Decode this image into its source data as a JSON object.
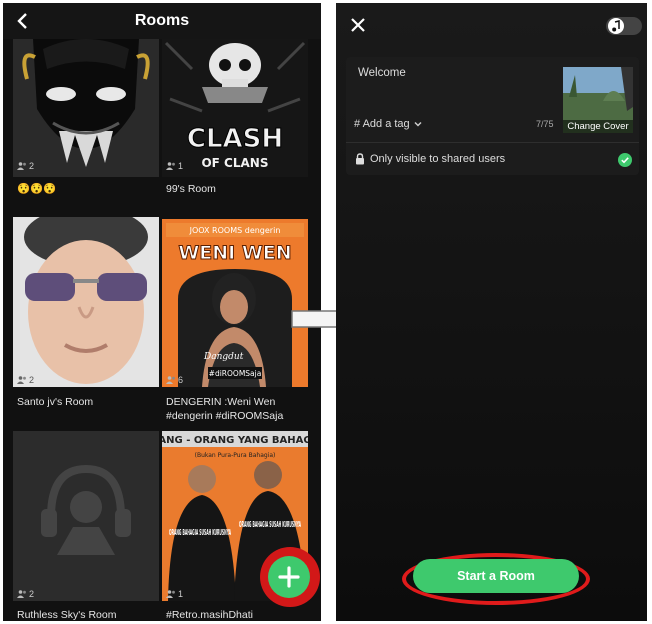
{
  "left_screen": {
    "title": "Rooms",
    "rooms": [
      {
        "name": "😯😯😯",
        "users": "2",
        "art": "demon-mask"
      },
      {
        "name": "99's Room",
        "users": "1",
        "art": "clash-of-clans"
      },
      {
        "name": "Santo jv's Room",
        "users": "2",
        "art": "man-sunglasses"
      },
      {
        "name": "DENGERIN :Weni Wen #dengerin #diROOMSaja",
        "users": "6",
        "art": "weni-wen-poster"
      },
      {
        "name": "Ruthless Sky's Room",
        "users": "2",
        "art": "headphones-placeholder"
      },
      {
        "name": "#Retro.masihDhati",
        "users": "1",
        "art": "orang-bahagia-poster"
      }
    ],
    "art_text": {
      "clash_top": "CLASH",
      "clash_bottom": "OF CLANS",
      "weni_header": "JOOX ROOMS dengerin",
      "weni_title": "WENI WEN",
      "weni_sub": "Dangdut",
      "weni_footer": "#diROOMSaja",
      "orang_header": "ANG - ORANG YANG BAHAG",
      "orang_sub": "(Bukan Pura-Pura Bahagia)",
      "orang_left": "ORANG BAHAGIA SUSAH KURUSNYA",
      "orang_right": "ORANG BAHAGIA SUSAH KURUSNYA"
    },
    "fab_label": "+"
  },
  "right_screen": {
    "room_name": "Welcome",
    "tag_label": "# Add a tag",
    "char_count": "7/75",
    "cover_label": "Change Cover",
    "visibility_label": "Only visible to shared users",
    "start_label": "Start a Room"
  },
  "colors": {
    "accent_green": "#3ec96d",
    "highlight_red": "#e01b1b",
    "background_dark": "#111111"
  }
}
